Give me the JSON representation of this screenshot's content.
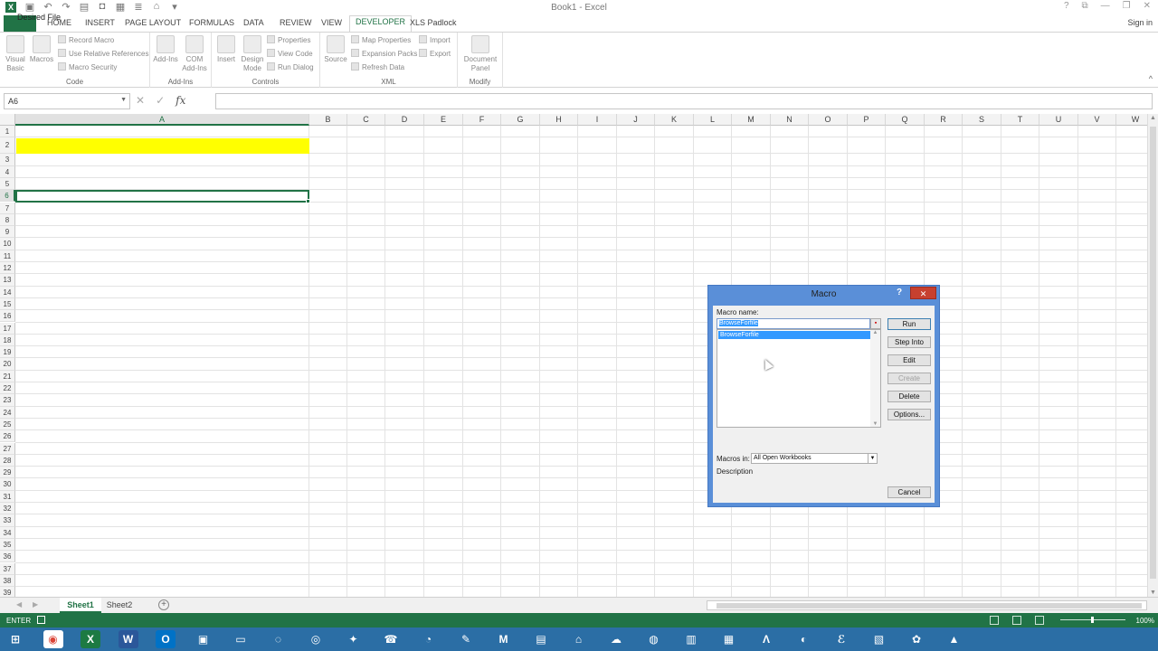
{
  "window": {
    "title": "Book1 - Excel"
  },
  "quick_access": [
    "save-icon",
    "undo-icon",
    "redo-icon",
    "print-preview-icon",
    "camera-icon",
    "form-icon",
    "sort-icon",
    "lock-icon",
    "customize-icon"
  ],
  "window_controls": [
    "?",
    "⧉",
    "—",
    "❐",
    "✕"
  ],
  "tabs": {
    "file": "FILE",
    "items": [
      "HOME",
      "INSERT",
      "PAGE LAYOUT",
      "FORMULAS",
      "DATA",
      "REVIEW",
      "VIEW",
      "DEVELOPER",
      "XLS Padlock"
    ],
    "active": "DEVELOPER",
    "signin": "Sign in"
  },
  "ribbon": {
    "code": {
      "label": "Code",
      "visual_basic": "Visual\nBasic",
      "macros": "Macros",
      "record_macro": "Record Macro",
      "use_relative": "Use Relative References",
      "macro_security": "Macro Security"
    },
    "addins": {
      "label": "Add-Ins",
      "addins": "Add-Ins",
      "com_addins": "COM\nAdd-Ins"
    },
    "controls": {
      "label": "Controls",
      "insert": "Insert",
      "design_mode": "Design\nMode",
      "properties": "Properties",
      "view_code": "View Code",
      "run_dialog": "Run Dialog"
    },
    "xml": {
      "label": "XML",
      "source": "Source",
      "map_properties": "Map Properties",
      "expansion_packs": "Expansion Packs",
      "refresh_data": "Refresh Data",
      "import": "Import",
      "export": "Export"
    },
    "modify": {
      "label": "Modify",
      "document_panel": "Document\nPanel"
    }
  },
  "formula_bar": {
    "name_box": "A6",
    "cancel": "✕",
    "enter": "✓",
    "fx": "fx",
    "value": ""
  },
  "grid": {
    "columns": [
      "A",
      "B",
      "C",
      "D",
      "E",
      "F",
      "G",
      "H",
      "I",
      "J",
      "K",
      "L",
      "M",
      "N",
      "O",
      "P",
      "Q",
      "R",
      "S",
      "T",
      "U",
      "V",
      "W"
    ],
    "rows": [
      "1",
      "2",
      "3",
      "4",
      "5",
      "6",
      "7",
      "8",
      "9",
      "10",
      "11",
      "12",
      "13",
      "14",
      "15",
      "16",
      "17",
      "18",
      "19",
      "20",
      "21",
      "22",
      "23",
      "24",
      "25",
      "26",
      "27",
      "28",
      "29",
      "30",
      "31",
      "32",
      "33",
      "34",
      "35",
      "36",
      "37",
      "38",
      "39"
    ],
    "active_cell": "A6",
    "cells": {
      "A1": "Desired File"
    },
    "highlight_color": "#ffff00"
  },
  "sheets": {
    "tabs": [
      "Sheet1",
      "Sheet2"
    ],
    "active": "Sheet1",
    "add": "+"
  },
  "status": {
    "mode": "ENTER",
    "zoom": "100%",
    "accent": "#217346"
  },
  "dialog": {
    "title": "Macro",
    "help": "?",
    "close": "✕",
    "macro_name_label": "Macro name:",
    "macro_name_value": "BrowseForfile",
    "list_items": [
      "BrowseForfile"
    ],
    "buttons": {
      "run": "Run",
      "step_into": "Step Into",
      "edit": "Edit",
      "create": "Create",
      "delete": "Delete",
      "options": "Options...",
      "cancel": "Cancel"
    },
    "macros_in_label": "Macros in:",
    "macros_in_value": "All Open Workbooks",
    "description_label": "Description"
  },
  "taskbar": [
    "start-icon",
    "chrome-icon",
    "excel-icon",
    "word-icon",
    "outlook-icon",
    "app-icon",
    "camera-app-icon",
    "browser-icon",
    "chrome-alt-icon",
    "folder-app-icon",
    "phone-icon",
    "clock-icon",
    "tool-icon",
    "m-icon",
    "explorer-icon",
    "mac-icon",
    "cloud-icon",
    "globe-icon",
    "doc-icon",
    "notes-icon",
    "a-icon",
    "firefox-icon",
    "e-icon",
    "doc2-icon",
    "paint-icon",
    "vlc-icon"
  ]
}
